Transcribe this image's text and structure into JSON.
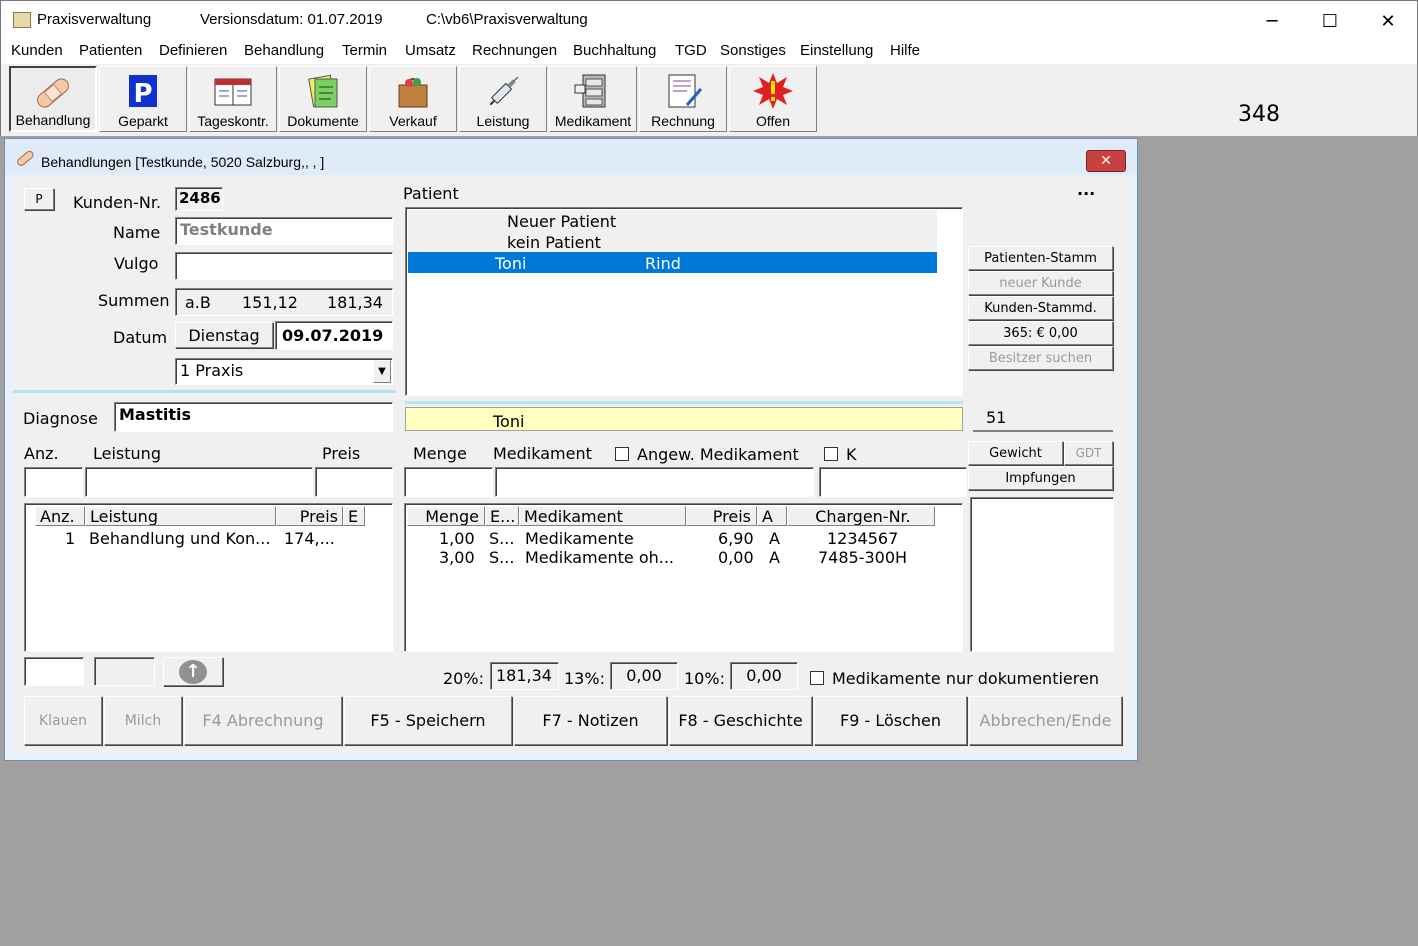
{
  "app": {
    "title": "Praxisverwaltung",
    "version": "Versionsdatum: 01.07.2019",
    "path": "C:\\vb6\\Praxisverwaltung"
  },
  "window_controls": {
    "minimize": "─",
    "maximize": "☐",
    "close": "✕"
  },
  "menu": [
    "Kunden",
    "Patienten",
    "Definieren",
    "Behandlung",
    "Termin",
    "Umsatz",
    "Rechnungen",
    "Buchhaltung",
    "TGD",
    "Sonstiges",
    "Einstellung",
    "Hilfe"
  ],
  "toolbar": [
    {
      "label": "Behandlung",
      "icon": "bandage-icon"
    },
    {
      "label": "Geparkt",
      "icon": "parking-icon"
    },
    {
      "label": "Tageskontr.",
      "icon": "calendar-book-icon"
    },
    {
      "label": "Dokumente",
      "icon": "documents-icon"
    },
    {
      "label": "Verkauf",
      "icon": "shopping-bag-icon"
    },
    {
      "label": "Leistung",
      "icon": "syringe-icon"
    },
    {
      "label": "Medikament",
      "icon": "cabinet-icon"
    },
    {
      "label": "Rechnung",
      "icon": "invoice-icon"
    },
    {
      "label": "Offen",
      "icon": "alert-burst-icon"
    }
  ],
  "counter": "348",
  "dialog": {
    "title": "Behandlungen [Testkunde, 5020 Salzburg,, , ]",
    "p_button": "P",
    "dots": "...",
    "kunden_nr_label": "Kunden-Nr.",
    "kunden_nr": "2486",
    "name_label": "Name",
    "name": "Testkunde",
    "vulgo_label": "Vulgo",
    "vulgo": "",
    "summen_label": "Summen",
    "summen_ab": "a.B",
    "summen_1": "151,12",
    "summen_2": "181,34",
    "datum_label": "Datum",
    "wochentag": "Dienstag",
    "datum": "09.07.2019",
    "praxis": "1  Praxis",
    "patient_label": "Patient",
    "patients": [
      {
        "a": "Neuer Patient",
        "b": ""
      },
      {
        "a": "kein Patient",
        "b": ""
      },
      {
        "a": "Toni",
        "b": "Rind"
      }
    ],
    "patient_selected": "Toni",
    "patient_count": "51",
    "side_buttons": {
      "patienten_stamm": "Patienten-Stamm",
      "neuer_kunde": "neuer Kunde",
      "kunden_stammd": "Kunden-Stammd.",
      "s365": "365:  € 0,00",
      "besitzer": "Besitzer suchen",
      "gewicht": "Gewicht",
      "gdt": "GDT",
      "impfungen": "Impfungen"
    },
    "diagnose_label": "Diagnose",
    "diagnose": "Mastitis",
    "col_anz": "Anz.",
    "col_leistung": "Leistung",
    "col_preis": "Preis",
    "col_menge": "Menge",
    "col_medikament": "Medikament",
    "angew_label": "Angew. Medikament",
    "k_label": "K",
    "leist_table": {
      "headers": [
        "Anz.",
        "Leistung",
        "Preis",
        "E"
      ],
      "rows": [
        {
          "anz": "1",
          "leistung": "Behandlung und Kon...",
          "preis": "174,...",
          "e": ""
        }
      ]
    },
    "med_table": {
      "headers": [
        "Menge",
        "E...",
        "Medikament",
        "Preis",
        "A",
        "Chargen-Nr."
      ],
      "rows": [
        {
          "menge": "1,00",
          "e": "S...",
          "med": "Medikamente",
          "preis": "6,90",
          "a": "A",
          "charge": "1234567"
        },
        {
          "menge": "3,00",
          "e": "S...",
          "med": "Medikamente oh...",
          "preis": "0,00",
          "a": "A",
          "charge": "7485-300H"
        }
      ]
    },
    "tax": {
      "l20": "20%:",
      "v20": "181,34",
      "l13": "13%:",
      "v13": "0,00",
      "l10": "10%:",
      "v10": "0,00"
    },
    "nur_doku_label": "Medikamente nur dokumentieren",
    "bottom_buttons": {
      "klauen": "Klauen",
      "milch": "Milch",
      "f4": "F4 Abrechnung",
      "f5": "F5 - Speichern",
      "f7": "F7 - Notizen",
      "f8": "F8 - Geschichte",
      "f9": "F9 - Löschen",
      "ende": "Abbrechen/Ende"
    }
  }
}
